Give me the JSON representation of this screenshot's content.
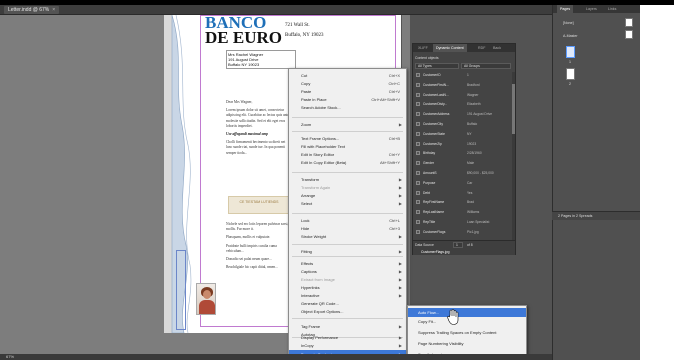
{
  "document": {
    "tab_title": "Letter.indd @ 67%",
    "zoom_status": "67%",
    "bank_line1": "BANCO",
    "bank_line2": "DE EURO",
    "address_line1": "721 Wall St.",
    "address_line2": "Buffalo, NY 19023",
    "recipient": [
      "Mrs Rachel Wagner",
      "191 August Drive",
      "Buffalo NY 19023"
    ],
    "salutation": "Dear Mrs Wagner,",
    "para1": "Lorem ipsum dolor sit amet, consectetur adipiscing elit. Curabitur ac lectus quis ante molestie sollicitudin. Sed et elit eget eros lobortis imperdiet.",
    "heading1": "Use affogandi maximal omp",
    "para2": "Cholli firmamenti becimento sa direit nei lunc sunde riat, sunde tue. In qua ponenti semper tioda...",
    "banner": "CE TIESTAM LUTIENDS",
    "para3": "Nichele sed ero lotis leporen pulvinar sarsi, mollis. Fur more it.",
    "para4": "Phasquam, mollis et vulputate.",
    "para5": "Praidrate bulli impiris curalia cuma vehiculum...",
    "para6": "Donadio sei pulat neum quare...",
    "closing": "Beachilgiale hic capit ditial, nmen..."
  },
  "context_menu": {
    "items": [
      {
        "label": "Cut",
        "shortcut": "Ctrl+X"
      },
      {
        "label": "Copy",
        "shortcut": "Ctrl+C"
      },
      {
        "label": "Paste",
        "shortcut": "Ctrl+V"
      },
      {
        "label": "Paste in Place",
        "shortcut": "Ctrl+Alt+Shift+V"
      },
      {
        "label": "Search Adobe Stock...",
        "shortcut": ""
      },
      {
        "label": "Zoom",
        "shortcut": ""
      },
      {
        "label": "Text Frame Options...",
        "shortcut": "Ctrl+B"
      },
      {
        "label": "Fill with Placeholder Text",
        "shortcut": ""
      },
      {
        "label": "Edit in Story Editor",
        "shortcut": "Ctrl+Y"
      },
      {
        "label": "Edit In Copy Editor (Beta)",
        "shortcut": "Alt+Shift+Y"
      },
      {
        "label": "Transform",
        "shortcut": ""
      },
      {
        "label": "Transform Again",
        "shortcut": ""
      },
      {
        "label": "Arrange",
        "shortcut": ""
      },
      {
        "label": "Select",
        "shortcut": ""
      },
      {
        "label": "Lock",
        "shortcut": "Ctrl+L"
      },
      {
        "label": "Hide",
        "shortcut": "Ctrl+3"
      },
      {
        "label": "Stroke Weight",
        "shortcut": ""
      },
      {
        "label": "Fitting",
        "shortcut": ""
      },
      {
        "label": "Effects",
        "shortcut": ""
      },
      {
        "label": "Captions",
        "shortcut": ""
      },
      {
        "label": "Extract from Image",
        "shortcut": ""
      },
      {
        "label": "Hyperlinks",
        "shortcut": ""
      },
      {
        "label": "Interactive",
        "shortcut": ""
      },
      {
        "label": "Generate QR Code...",
        "shortcut": ""
      },
      {
        "label": "Object Export Options...",
        "shortcut": ""
      },
      {
        "label": "Tag Frame",
        "shortcut": ""
      },
      {
        "label": "Autotag",
        "shortcut": ""
      },
      {
        "label": "Display Performance",
        "shortcut": ""
      },
      {
        "label": "InCopy",
        "shortcut": ""
      },
      {
        "label": "Dynamic Content",
        "shortcut": ""
      }
    ]
  },
  "submenu": {
    "items": [
      {
        "label": "Auto Flow..."
      },
      {
        "label": "Copy Fit..."
      },
      {
        "label": "Suppress Trailing Spaces on Empty Content"
      },
      {
        "label": "Page Numbering Visibility"
      },
      {
        "label": "Specify Imaging..."
      }
    ]
  },
  "data_merge_panel": {
    "tabs": [
      "XLIFF",
      "Dynamic Content",
      "RDF",
      "Back"
    ],
    "content_objects_label": "Content objects",
    "filter_all_types": "All Types",
    "filter_all_groups": "All Groups",
    "fields": [
      {
        "name": "CustomerID",
        "value": "1"
      },
      {
        "name": "CustomerFirstN...",
        "value": "Bradford"
      },
      {
        "name": "CustomerLastN...",
        "value": "Wagner"
      },
      {
        "name": "CustomerDisty...",
        "value": "Elizabeth"
      },
      {
        "name": "CustomerAddress",
        "value": "191 August Drive"
      },
      {
        "name": "CustomerCity",
        "value": "Buffalo"
      },
      {
        "name": "CustomerState",
        "value": "NY"
      },
      {
        "name": "CustomerZip",
        "value": "19023"
      },
      {
        "name": "Birthday",
        "value": "2/28/1960"
      },
      {
        "name": "Gender",
        "value": "Male"
      },
      {
        "name": "AmountS",
        "value": "$90,000 - $25,000"
      },
      {
        "name": "Purpose",
        "value": "Car"
      },
      {
        "name": "Debt",
        "value": "Yes"
      },
      {
        "name": "RepFirstName",
        "value": "Brad"
      },
      {
        "name": "RepLastName",
        "value": "Williams"
      },
      {
        "name": "RepTitle",
        "value": "Loan Specialist"
      },
      {
        "name": "CustomerFlags",
        "value": "Pic1.jpg"
      }
    ],
    "data_source_label": "Data Source",
    "record_number": "1",
    "record_total": "of 8",
    "bottom_field": "CustomerFlags.jpg"
  },
  "pages_panel": {
    "tabs": [
      "Pages",
      "Layers",
      "Links"
    ],
    "none_label": "[None]",
    "master_label": "A-Master",
    "page_numbers": [
      "1",
      "2"
    ],
    "footer": "2 Pages in 2 Spreads"
  }
}
